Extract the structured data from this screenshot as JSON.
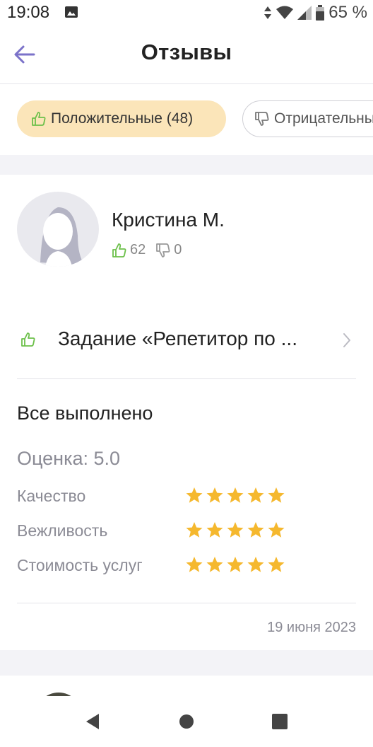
{
  "status": {
    "time": "19:08",
    "battery": "65 %"
  },
  "header": {
    "title": "Отзывы"
  },
  "filters": {
    "positive_label": "Положительные (48)",
    "negative_label": "Отрицательные"
  },
  "review": {
    "author": "Кристина М.",
    "likes": "62",
    "dislikes": "0",
    "task_title": "Задание «Репетитор по ...",
    "comment": "Все выполнено",
    "score_label": "Оценка: 5.0",
    "criteria": [
      {
        "label": "Качество",
        "stars": 5
      },
      {
        "label": "Вежливость",
        "stars": 5
      },
      {
        "label": "Стоимость услуг",
        "stars": 5
      }
    ],
    "date": "19 июня 2023"
  },
  "colors": {
    "accent": "#7b72c9",
    "chip_active": "#fbe5b9",
    "star": "#f5b82e",
    "like": "#6cc04a"
  },
  "icons": [
    "back-arrow-icon",
    "thumb-up-icon",
    "thumb-down-icon",
    "chevron-right-icon",
    "star-icon"
  ]
}
